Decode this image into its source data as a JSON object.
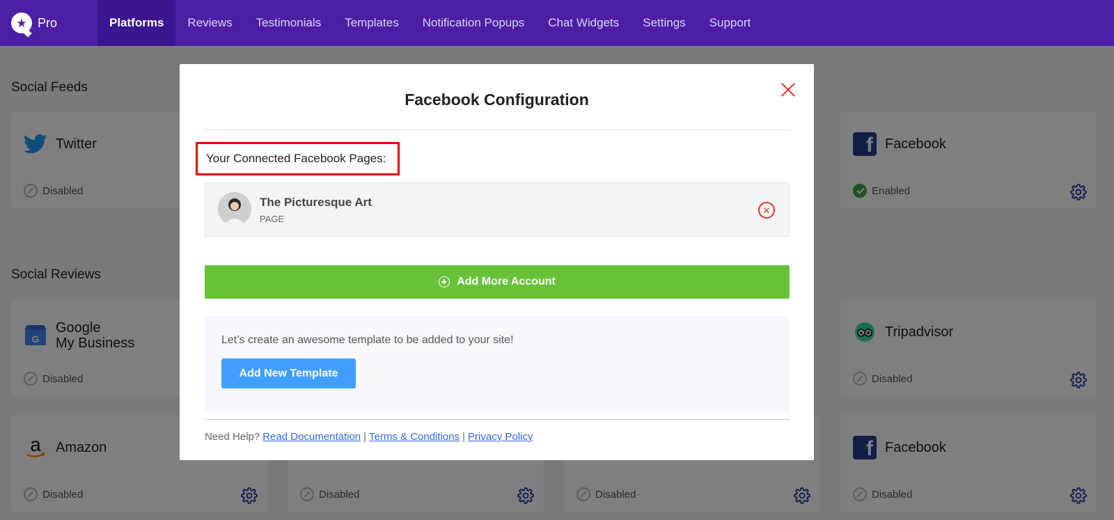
{
  "brand": {
    "name": "Pro"
  },
  "nav": {
    "items": [
      "Platforms",
      "Reviews",
      "Testimonials",
      "Templates",
      "Notification Popups",
      "Chat Widgets",
      "Settings",
      "Support"
    ],
    "active": "Platforms"
  },
  "sections": {
    "social_feeds": "Social Feeds",
    "social_reviews": "Social Reviews"
  },
  "cards": {
    "twitter": {
      "name": "Twitter",
      "status": "Disabled"
    },
    "facebook_feed": {
      "name": "Facebook",
      "status": "Enabled"
    },
    "google": {
      "name_line1": "Google",
      "name_line2": "My Business",
      "status": "Disabled"
    },
    "tripadvisor": {
      "name": "Tripadvisor",
      "status": "Disabled"
    },
    "amazon": {
      "name": "Amazon",
      "status": "Disabled"
    },
    "blank1": {
      "status": "Disabled"
    },
    "blank2": {
      "status": "Disabled"
    },
    "facebook_reviews": {
      "name": "Facebook",
      "status": "Disabled"
    }
  },
  "modal": {
    "title": "Facebook Configuration",
    "connected_label": "Your Connected Facebook Pages:",
    "page": {
      "name": "The Picturesque Art",
      "type": "PAGE"
    },
    "add_more_label": "Add More Account",
    "template_text": "Let’s create an awesome template to be added to your site!",
    "add_template_label": "Add New Template",
    "help": {
      "prefix": "Need Help?",
      "docs": "Read Documentation",
      "sep": "|",
      "terms": "Terms & Conditions",
      "privacy": "Privacy Policy"
    }
  },
  "colors": {
    "nav_bg": "#4b1ea4",
    "nav_active": "#3a1590",
    "green": "#67c23a",
    "blue": "#409eff",
    "red": "#e0322b",
    "gear": "#2c3e9e"
  },
  "icons": {
    "twitter": "twitter-bird-icon",
    "facebook": "facebook-f-icon",
    "google": "google-my-business-icon",
    "tripadvisor": "tripadvisor-owl-icon",
    "amazon": "amazon-logo-icon",
    "gear": "gear-icon"
  }
}
